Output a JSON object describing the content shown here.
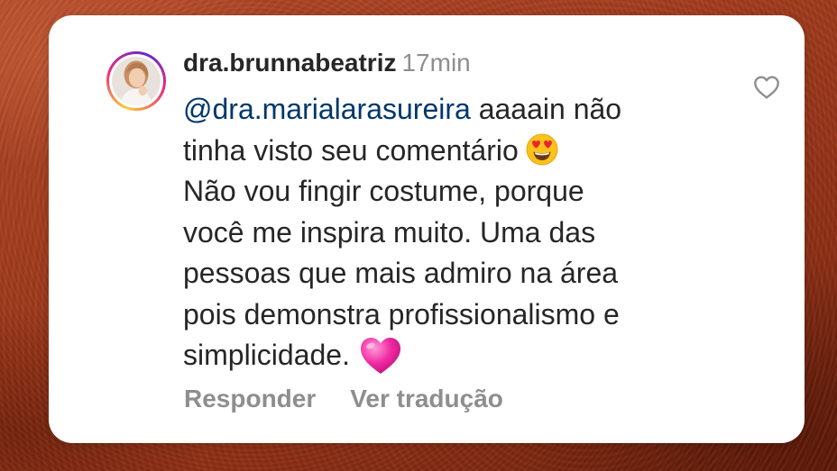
{
  "comment": {
    "username": "dra.brunnabeatriz",
    "time_ago": "17min",
    "mention": "@dra.marialarasureira",
    "lines": [
      "aaaain não",
      "tinha visto seu comentário",
      "Não vou fingir costume, porque",
      "você me inspira muito. Uma das",
      "pessoas que mais admiro na área",
      "pois demonstra profissionalismo e",
      "simplicidade."
    ],
    "emojis": [
      "heart-eyes-emoji",
      "pink-heart-emoji"
    ]
  },
  "actions": {
    "reply_label": "Responder",
    "translate_label": "Ver tradução"
  },
  "icons": {
    "like": "heart-outline-icon",
    "avatar": "profile-avatar"
  },
  "colors": {
    "background": "#a23c1e",
    "card": "#ffffff",
    "text": "#262626",
    "mention": "#00376b",
    "secondary_text": "#8e8e8e",
    "story_ring_start": "#f9ce34",
    "story_ring_end": "#ee2a7b"
  }
}
